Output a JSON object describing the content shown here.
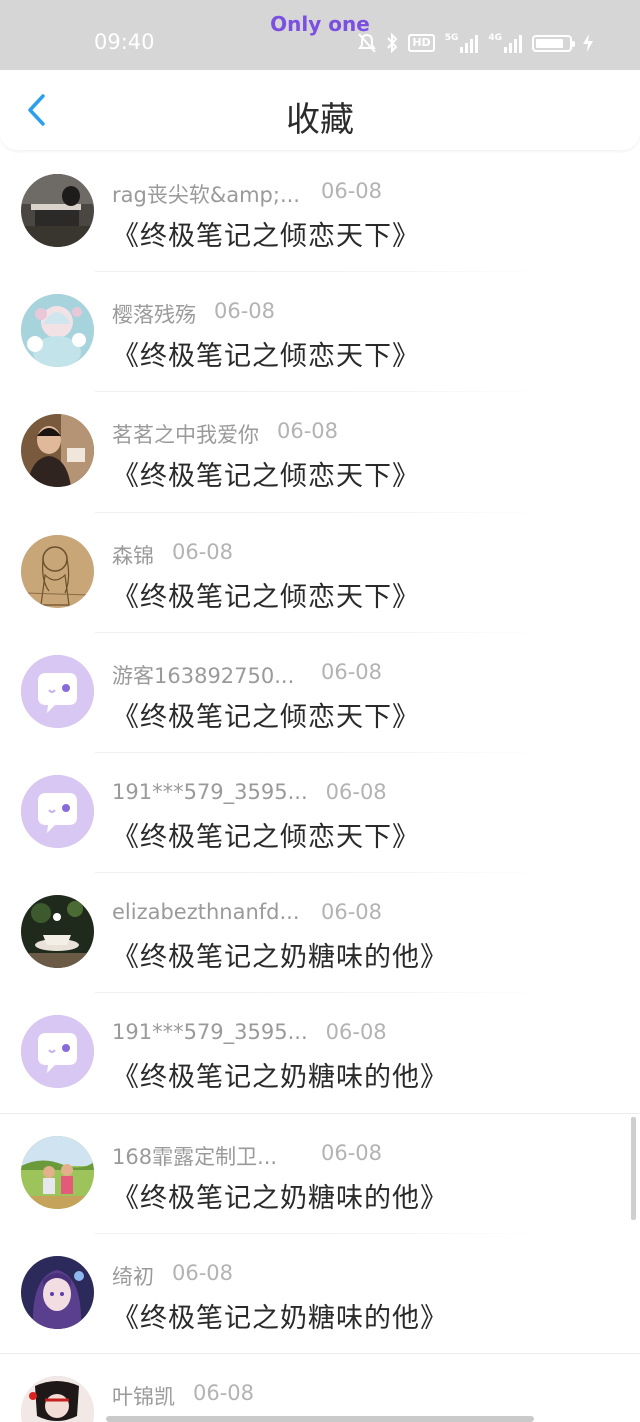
{
  "status_bar": {
    "carrier": "Only one",
    "time": "09:40",
    "hd_label": "HD",
    "signal1_label": "5G",
    "signal2_label": "4G",
    "battery_level": 0.85,
    "icons": [
      "mute-icon",
      "bluetooth-icon",
      "hd-icon",
      "signal-5g-icon",
      "signal-4g-icon",
      "battery-icon",
      "charging-icon"
    ]
  },
  "header": {
    "title": "收藏",
    "back_icon": "chevron-left-icon",
    "accent_color": "#2a9ff0"
  },
  "items": [
    {
      "name": "rag丧尖软&amp;...",
      "date": "06-08",
      "book": "《终极笔记之倾恋天下》",
      "avatar": "photo-laptop"
    },
    {
      "name": "樱落残殇",
      "date": "06-08",
      "book": "《终极笔记之倾恋天下》",
      "avatar": "anime-flowers"
    },
    {
      "name": "茗茗之中我爱你",
      "date": "06-08",
      "book": "《终极笔记之倾恋天下》",
      "avatar": "photo-man"
    },
    {
      "name": "森锦",
      "date": "06-08",
      "book": "《终极笔记之倾恋天下》",
      "avatar": "sketch-girl"
    },
    {
      "name": "游客163892750...",
      "date": "06-08",
      "book": "《终极笔记之倾恋天下》",
      "avatar": "default-chat"
    },
    {
      "name": "191***579_3595...",
      "date": "06-08",
      "book": "《终极笔记之倾恋天下》",
      "avatar": "default-chat"
    },
    {
      "name": "elizabezthnanfd...",
      "date": "06-08",
      "book": "《终极笔记之奶糖味的他》",
      "avatar": "photo-teacup"
    },
    {
      "name": "191***579_3595...",
      "date": "06-08",
      "book": "《终极笔记之奶糖味的他》",
      "avatar": "default-chat"
    },
    {
      "name": "168霏露定制卫...",
      "date": "06-08",
      "book": "《终极笔记之奶糖味的他》",
      "avatar": "photo-kids"
    },
    {
      "name": "绮初",
      "date": "06-08",
      "book": "《终极笔记之奶糖味的他》",
      "avatar": "anime-girl-purple"
    },
    {
      "name": "叶锦凯",
      "date": "06-08",
      "book": "",
      "avatar": "anime-mask"
    }
  ]
}
